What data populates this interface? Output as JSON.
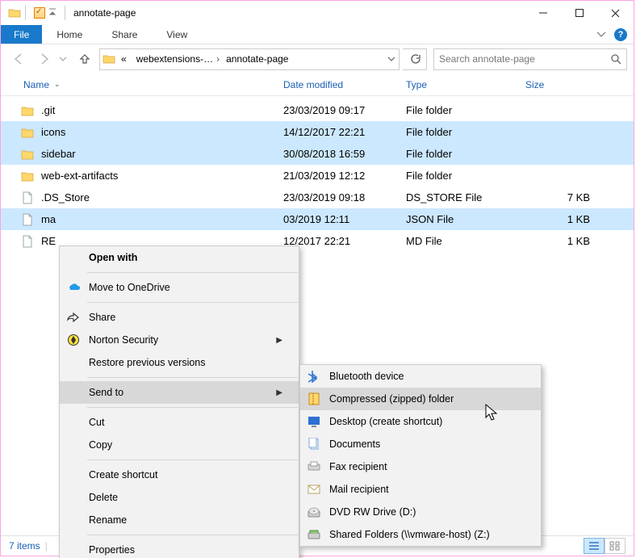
{
  "title": "annotate-page",
  "ribbon": {
    "file": "File",
    "home": "Home",
    "share": "Share",
    "view": "View"
  },
  "breadcrumb": {
    "seg1": "webextensions-…",
    "seg2": "annotate-page"
  },
  "search": {
    "placeholder": "Search annotate-page"
  },
  "columns": {
    "name": "Name",
    "date": "Date modified",
    "type": "Type",
    "size": "Size"
  },
  "rows": [
    {
      "icon": "folder",
      "name": ".git",
      "date": "23/03/2019 09:17",
      "type": "File folder",
      "size": "",
      "sel": false
    },
    {
      "icon": "folder",
      "name": "icons",
      "date": "14/12/2017 22:21",
      "type": "File folder",
      "size": "",
      "sel": true
    },
    {
      "icon": "folder",
      "name": "sidebar",
      "date": "30/08/2018 16:59",
      "type": "File folder",
      "size": "",
      "sel": true
    },
    {
      "icon": "folder",
      "name": "web-ext-artifacts",
      "date": "21/03/2019 12:12",
      "type": "File folder",
      "size": "",
      "sel": false
    },
    {
      "icon": "file",
      "name": ".DS_Store",
      "date": "23/03/2019 09:18",
      "type": "DS_STORE File",
      "size": "7 KB",
      "sel": false
    },
    {
      "icon": "file",
      "name": "ma",
      "date": "03/2019 12:11",
      "type": "JSON File",
      "size": "1 KB",
      "sel": true
    },
    {
      "icon": "file",
      "name": "RE",
      "date": "12/2017 22:21",
      "type": "MD File",
      "size": "1 KB",
      "sel": false
    }
  ],
  "ctx1": {
    "open_with": "Open with",
    "onedrive": "Move to OneDrive",
    "share": "Share",
    "norton": "Norton Security",
    "restore": "Restore previous versions",
    "sendto": "Send to",
    "cut": "Cut",
    "copy": "Copy",
    "create_shortcut": "Create shortcut",
    "delete": "Delete",
    "rename": "Rename",
    "properties": "Properties"
  },
  "ctx2": {
    "bluetooth": "Bluetooth device",
    "zip": "Compressed (zipped) folder",
    "desktop": "Desktop (create shortcut)",
    "documents": "Documents",
    "fax": "Fax recipient",
    "mail": "Mail recipient",
    "dvd": "DVD RW Drive (D:)",
    "shared": "Shared Folders (\\\\vmware-host) (Z:)"
  },
  "status": {
    "items": "7 items",
    "selected_suffix": ""
  }
}
